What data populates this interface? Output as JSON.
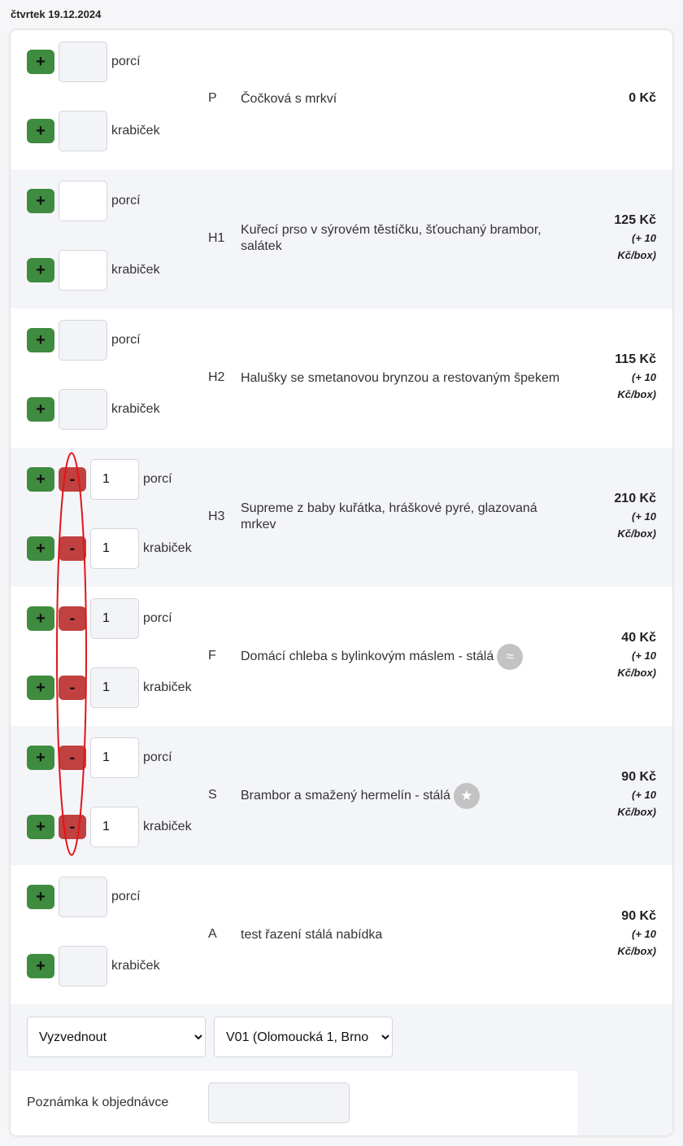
{
  "date_heading": "čtvrtek 19.12.2024",
  "labels": {
    "portions": "porcí",
    "boxes": "krabiček"
  },
  "buttons": {
    "plus": "+",
    "minus": "-"
  },
  "dishes": [
    {
      "code": "P",
      "name": "Čočková s mrkví",
      "price": "0 Kč",
      "extra": "",
      "portions_value": "",
      "boxes_value": ""
    },
    {
      "code": "H1",
      "name": "Kuřecí prso v sýrovém těstíčku, šťouchaný brambor, salátek",
      "price": "125 Kč",
      "extra": "(+ 10 Kč/box)",
      "portions_value": "",
      "boxes_value": ""
    },
    {
      "code": "H2",
      "name": "Halušky se smetanovou brynzou a restovaným špekem",
      "price": "115 Kč",
      "extra": "(+ 10 Kč/box)",
      "portions_value": "",
      "boxes_value": ""
    },
    {
      "code": "H3",
      "name": "Supreme z baby kuřátka, hráškové pyré, glazovaná mrkev",
      "price": "210 Kč",
      "extra": "(+ 10 Kč/box)",
      "portions_value": "1",
      "boxes_value": "1"
    },
    {
      "code": "F",
      "name": "Domácí chleba s bylinkovým máslem - stálá",
      "price": "40 Kč",
      "extra": "(+ 10 Kč/box)",
      "portions_value": "1",
      "boxes_value": "1",
      "icon": "bread-icon"
    },
    {
      "code": "S",
      "name": "Brambor a smažený hermelín - stálá",
      "price": "90 Kč",
      "extra": "(+ 10 Kč/box)",
      "portions_value": "1",
      "boxes_value": "1",
      "icon": "star-icon"
    },
    {
      "code": "A",
      "name": "test řazení stálá nabídka",
      "price": "90 Kč",
      "extra": "(+ 10 Kč/box)",
      "portions_value": "",
      "boxes_value": ""
    }
  ],
  "delivery_select": {
    "value": "Vyzvednout"
  },
  "location_select": {
    "value": "V01 (Olomoucká 1, Brno"
  },
  "note": {
    "label": "Poznámka k objednávce",
    "value": ""
  },
  "colors": {
    "plus": "#3f8b3f",
    "minus": "#c0413f",
    "annotation": "#e0151b"
  }
}
